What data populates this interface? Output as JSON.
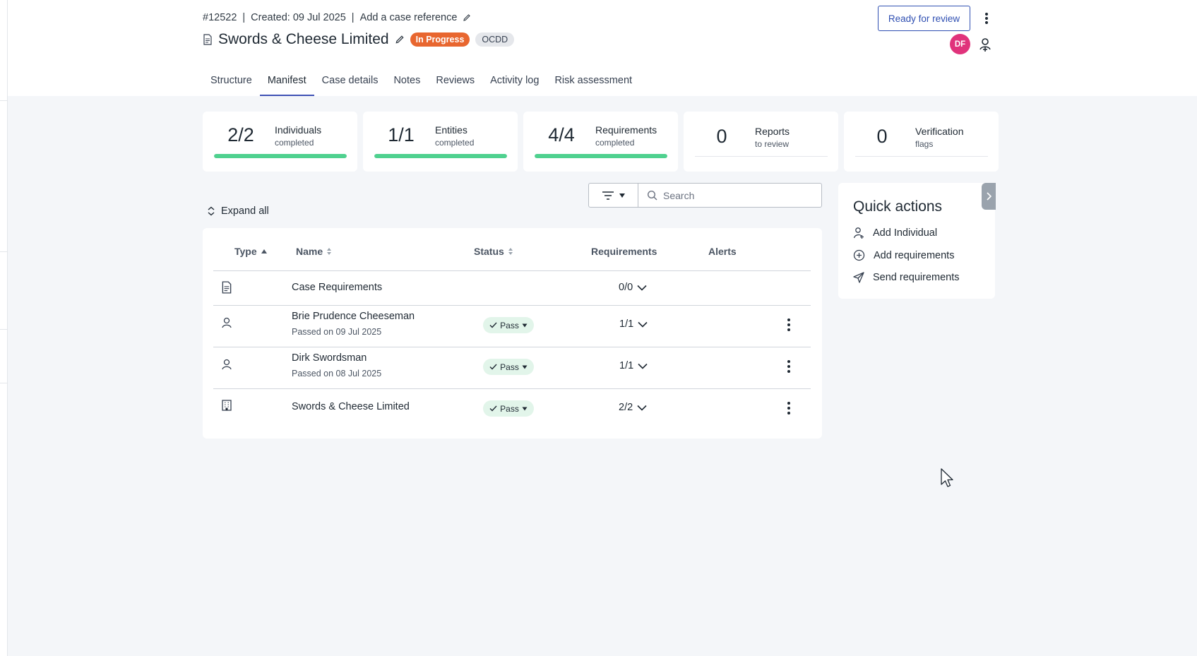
{
  "case": {
    "id": "#12522",
    "created": "Created: 09 Jul 2025",
    "add_reference": "Add a case reference",
    "title": "Swords & Cheese Limited",
    "status_badge": "In Progress",
    "tag": "OCDD",
    "status_color": "#e8662f"
  },
  "actions": {
    "ready_for_review": "Ready for review",
    "avatar_initials": "DF",
    "avatar_color": "#e0337b"
  },
  "tabs": [
    {
      "label": "Structure",
      "active": false
    },
    {
      "label": "Manifest",
      "active": true
    },
    {
      "label": "Case details",
      "active": false
    },
    {
      "label": "Notes",
      "active": false
    },
    {
      "label": "Reviews",
      "active": false
    },
    {
      "label": "Activity log",
      "active": false
    },
    {
      "label": "Risk assessment",
      "active": false
    }
  ],
  "stats": [
    {
      "value": "2/2",
      "label": "Individuals",
      "sub": "completed",
      "progress": 1.0
    },
    {
      "value": "1/1",
      "label": "Entities",
      "sub": "completed",
      "progress": 1.0
    },
    {
      "value": "4/4",
      "label": "Requirements",
      "sub": "completed",
      "progress": 1.0
    },
    {
      "value": "0",
      "label": "Reports",
      "sub": "to review",
      "progress": null
    },
    {
      "value": "0",
      "label": "Verification",
      "sub": "flags",
      "progress": null
    }
  ],
  "toolbar": {
    "search_placeholder": "Search",
    "expand_all": "Expand all"
  },
  "table": {
    "columns": {
      "type": "Type",
      "name": "Name",
      "status": "Status",
      "requirements": "Requirements",
      "alerts": "Alerts"
    },
    "rows": [
      {
        "type_icon": "document-icon",
        "name": "Case Requirements",
        "sub": "",
        "status": "",
        "requirements": "0/0"
      },
      {
        "type_icon": "person-icon",
        "name": "Brie Prudence Cheeseman",
        "sub": "Passed on 09 Jul 2025",
        "status": "Pass",
        "requirements": "1/1"
      },
      {
        "type_icon": "person-icon",
        "name": "Dirk Swordsman",
        "sub": "Passed on 08 Jul 2025",
        "status": "Pass",
        "requirements": "1/1"
      },
      {
        "type_icon": "building-icon",
        "name": "Swords & Cheese Limited",
        "sub": "",
        "status": "Pass",
        "requirements": "2/2"
      }
    ]
  },
  "quick_actions": {
    "title": "Quick actions",
    "items": [
      {
        "label": "Add Individual",
        "icon": "add-person-icon"
      },
      {
        "label": "Add requirements",
        "icon": "plus-circle-icon"
      },
      {
        "label": "Send requirements",
        "icon": "send-icon"
      }
    ]
  },
  "colors": {
    "accent": "#3f51b5",
    "progress": "#4fd18f",
    "pass_bg": "#e2f5ea",
    "background": "#f4f6f9"
  }
}
